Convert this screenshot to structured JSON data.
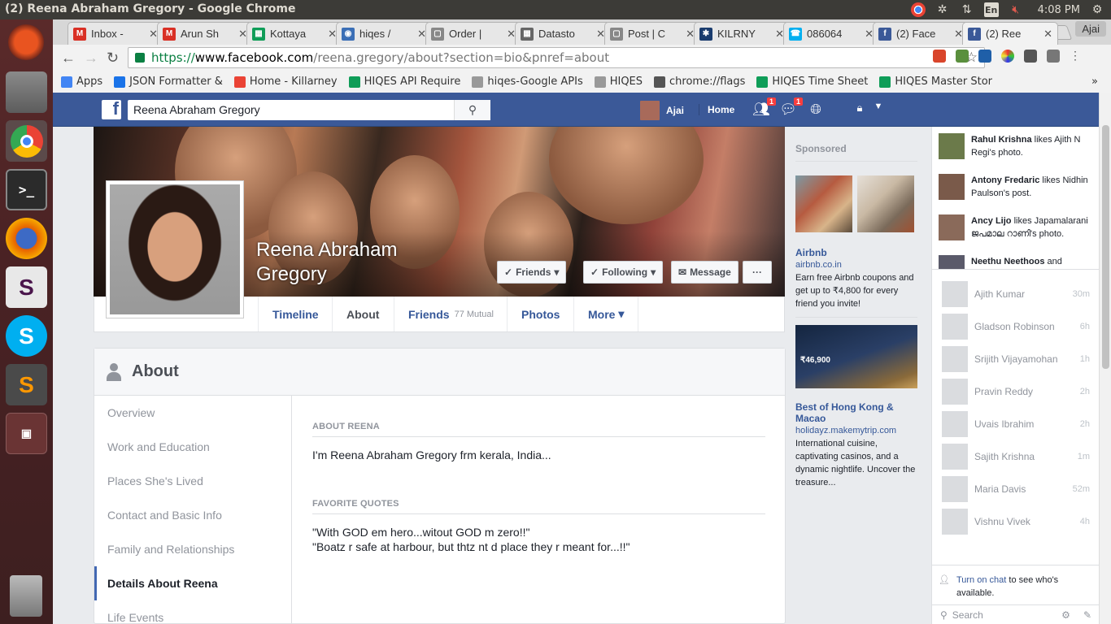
{
  "os": {
    "window_title": "(2) Reena Abraham Gregory - Google Chrome",
    "keyboard_layout": "En",
    "time": "4:08 PM",
    "launcher_icons": [
      "ubuntu-icon",
      "files-icon",
      "chrome-icon",
      "terminal-icon",
      "firefox-icon",
      "slack-icon",
      "skype-icon",
      "sublime-icon",
      "workspace-icon",
      "trash-icon"
    ]
  },
  "browser": {
    "tabs": [
      {
        "label": "Inbox -",
        "fav": "M",
        "color": "#d93025"
      },
      {
        "label": "Arun Sh",
        "fav": "M",
        "color": "#d93025"
      },
      {
        "label": "Kottaya",
        "fav": "▦",
        "color": "#0f9d58"
      },
      {
        "label": "hiqes /",
        "fav": "◉",
        "color": "#3b6fb6"
      },
      {
        "label": "Order |",
        "fav": "▢",
        "color": "#888888"
      },
      {
        "label": "Datasto",
        "fav": "▦",
        "color": "#666666"
      },
      {
        "label": "Post | C",
        "fav": "▢",
        "color": "#888888"
      },
      {
        "label": "KILRNY",
        "fav": "✱",
        "color": "#1a3c6e"
      },
      {
        "label": "086064",
        "fav": "☎",
        "color": "#00aff0"
      },
      {
        "label": "(2) Face",
        "fav": "f",
        "color": "#3b5998"
      },
      {
        "label": "(2) Ree",
        "fav": "f",
        "color": "#3b5998"
      }
    ],
    "profile_name": "Ajai",
    "url_scheme": "https://",
    "url_host": "www.facebook.com",
    "url_path": "/reena.gregory/about?section=bio&pnref=about",
    "bookmarks": [
      {
        "label": "Apps",
        "color": "#4285f4"
      },
      {
        "label": "JSON Formatter &",
        "color": "#1a73e8"
      },
      {
        "label": "Home - Killarney",
        "color": "#ea4335"
      },
      {
        "label": "HIQES API Require",
        "color": "#0f9d58"
      },
      {
        "label": "hiqes-Google APIs",
        "color": "#999999"
      },
      {
        "label": "HIQES",
        "color": "#999999"
      },
      {
        "label": "chrome://flags",
        "color": "#555555"
      },
      {
        "label": "HIQES Time Sheet",
        "color": "#0f9d58"
      },
      {
        "label": "HIQES Master Stor",
        "color": "#0f9d58"
      }
    ],
    "bookmarks_more": "»"
  },
  "facebook": {
    "search_value": "Reena Abraham Gregory",
    "user_name": "Ajai",
    "home_label": "Home",
    "friend_requests_badge": "1",
    "messages_badge": "1",
    "profile_name": "Reena Abraham Gregory",
    "buttons": {
      "friends": "Friends",
      "following": "Following",
      "message": "Message",
      "more": "···"
    },
    "timeline_tabs": {
      "timeline": "Timeline",
      "about": "About",
      "friends": "Friends",
      "mutual": "77 Mutual",
      "photos": "Photos",
      "more": "More"
    },
    "about": {
      "title": "About",
      "nav": [
        "Overview",
        "Work and Education",
        "Places She's Lived",
        "Contact and Basic Info",
        "Family and Relationships",
        "Details About Reena",
        "Life Events"
      ],
      "about_heading": "ABOUT REENA",
      "about_text": "I'm Reena Abraham Gregory frm kerala, India...",
      "quotes_heading": "FAVORITE QUOTES",
      "quote_1": "\"With GOD em hero...witout GOD m zero!!\"",
      "quote_2": "\"Boatz r safe at harbour, but thtz nt d place they r meant for...!!\""
    },
    "ads": {
      "sponsored": "Sponsored",
      "ad1_name": "Airbnb",
      "ad1_url": "airbnb.co.in",
      "ad1_text": "Earn free Airbnb coupons and get up to ₹4,800 for every friend you invite!",
      "ad2_name": "Best of Hong Kong & Macao",
      "ad2_url": "holidayz.makemytrip.com",
      "ad2_text": "International cuisine, captivating casinos, and a dynamic nightlife. Uncover the treasure...",
      "ad2_banner_price": "₹46,900"
    },
    "ticker": [
      {
        "name": "Rahul Krishna",
        "rest": " likes Ajith N Regi's photo."
      },
      {
        "name": "Antony Fredaric",
        "rest": " likes Nidhin Paulson's post."
      },
      {
        "name": "Ancy Lijo",
        "rest": " likes Japamalarani ജപമാല റാണി's photo."
      },
      {
        "name": "Neethu Neethoos",
        "rest": " and"
      }
    ],
    "chat": [
      {
        "name": "Ajith Kumar",
        "time": "30m"
      },
      {
        "name": "Gladson Robinson",
        "time": "6h"
      },
      {
        "name": "Srijith Vijayamohan",
        "time": "1h"
      },
      {
        "name": "Pravin Reddy",
        "time": "2h"
      },
      {
        "name": "Uvais Ibrahim",
        "time": "2h"
      },
      {
        "name": "Sajith Krishna",
        "time": "1m"
      },
      {
        "name": "Maria Davis",
        "time": "52m"
      },
      {
        "name": "Vishnu Vivek",
        "time": "4h"
      }
    ],
    "turn_on_chat_link": "Turn on chat",
    "turn_on_chat_rest": " to see who's available.",
    "chat_search_placeholder": "Search"
  }
}
